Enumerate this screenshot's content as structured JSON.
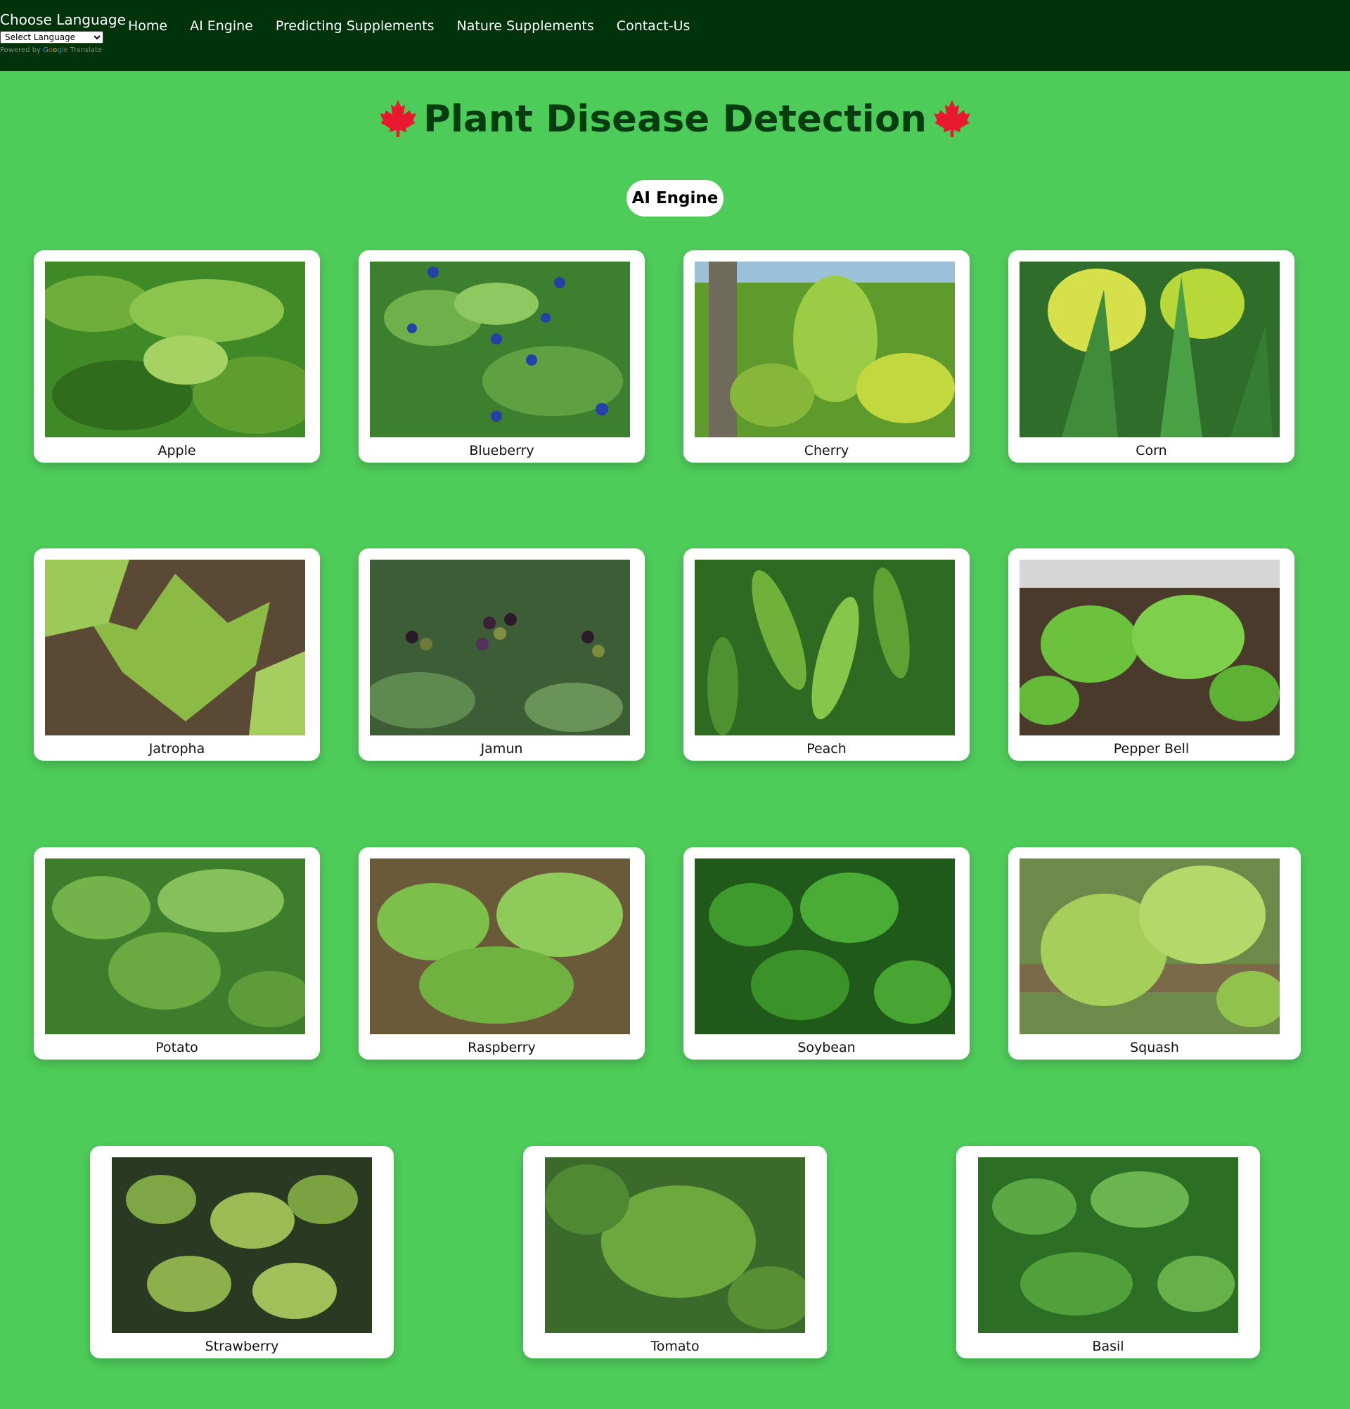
{
  "header": {
    "language_label": "Choose Language",
    "language_select": "Select Language",
    "powered_by": "Powered by",
    "powered_brand": [
      "G",
      "o",
      "o",
      "g",
      "l",
      "e"
    ],
    "powered_translate": "Translate",
    "nav": [
      "Home",
      "AI Engine",
      "Predicting Supplements",
      "Nature Supplements",
      "Contact-Us"
    ]
  },
  "title": "Plant Disease Detection",
  "title_icon": "maple-leaf-icon",
  "engine_button": "AI Engine",
  "colors": {
    "page_bg": "#4ecc5a",
    "navbar_bg": "#01330b",
    "title_text": "#053d11",
    "leaf_icon": "#e8182e",
    "card_bg": "#ffffff"
  },
  "plants": [
    {
      "label": "Apple",
      "image": "apple-leaves-photo"
    },
    {
      "label": "Blueberry",
      "image": "blueberry-bush-photo"
    },
    {
      "label": "Cherry",
      "image": "cherry-leaves-photo"
    },
    {
      "label": "Corn",
      "image": "corn-plants-photo"
    },
    {
      "label": "Jatropha",
      "image": "jatropha-leaves-photo"
    },
    {
      "label": "Jamun",
      "image": "jamun-berries-photo"
    },
    {
      "label": "Peach",
      "image": "peach-leaves-photo"
    },
    {
      "label": "Pepper Bell",
      "image": "pepper-bell-plants-photo"
    },
    {
      "label": "Potato",
      "image": "potato-plants-photo"
    },
    {
      "label": "Raspberry",
      "image": "raspberry-leaves-photo"
    },
    {
      "label": "Soybean",
      "image": "soybean-leaves-photo"
    },
    {
      "label": "Squash",
      "image": "squash-leaves-photo"
    },
    {
      "label": "Strawberry",
      "image": "strawberry-leaves-photo"
    },
    {
      "label": "Tomato",
      "image": "tomato-plant-photo"
    },
    {
      "label": "Basil",
      "image": "basil-leaves-photo"
    }
  ]
}
